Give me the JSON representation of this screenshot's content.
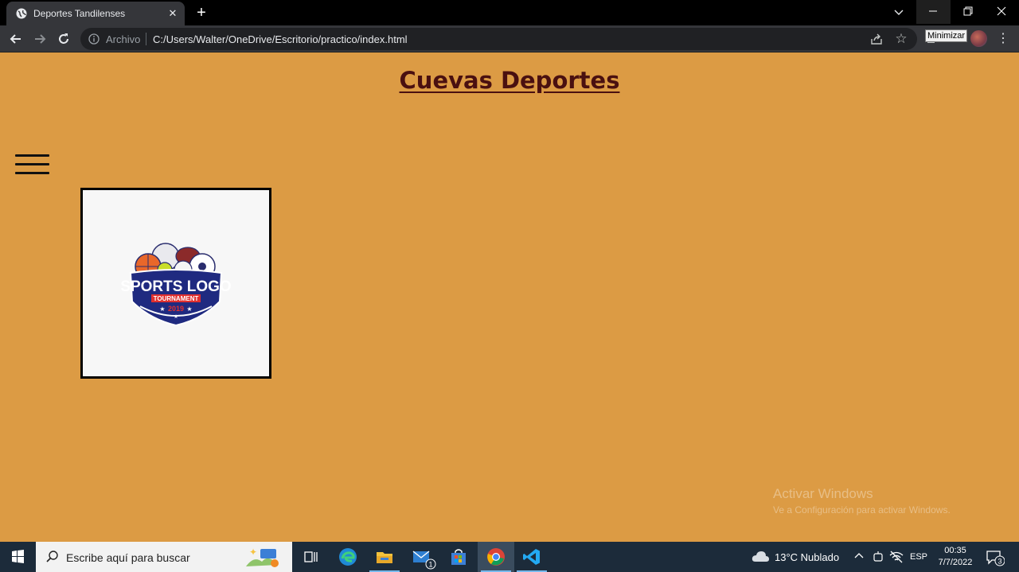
{
  "browser": {
    "tab_title": "Deportes Tandilenses",
    "tab_close_glyph": "✕",
    "new_tab_glyph": "+",
    "address_scheme": "Archivo",
    "address_url": "C:/Users/Walter/OneDrive/Escritorio/practico/index.html",
    "tooltip": "Minimizar",
    "menu_glyph": "⋮",
    "star_glyph": "☆",
    "theme_colors": {
      "tabbar": "#000000",
      "toolbar": "#35363a",
      "omnibox": "#202124"
    }
  },
  "page": {
    "background": "#dc9b44",
    "title": "Cuevas Deportes",
    "title_color": "#4a1010",
    "logo": {
      "main_text": "SPORTS LOGO",
      "ribbon_text": "TOURNAMENT",
      "year": "2019"
    }
  },
  "watermark": {
    "line1": "Activar Windows",
    "line2": "Ve a Configuración para activar Windows."
  },
  "taskbar": {
    "search_placeholder": "Escribe aquí para buscar",
    "weather": "13°C  Nublado",
    "language": "ESP",
    "time": "00:35",
    "date": "7/7/2022",
    "notification_count": "3",
    "mail_badge": "1"
  }
}
